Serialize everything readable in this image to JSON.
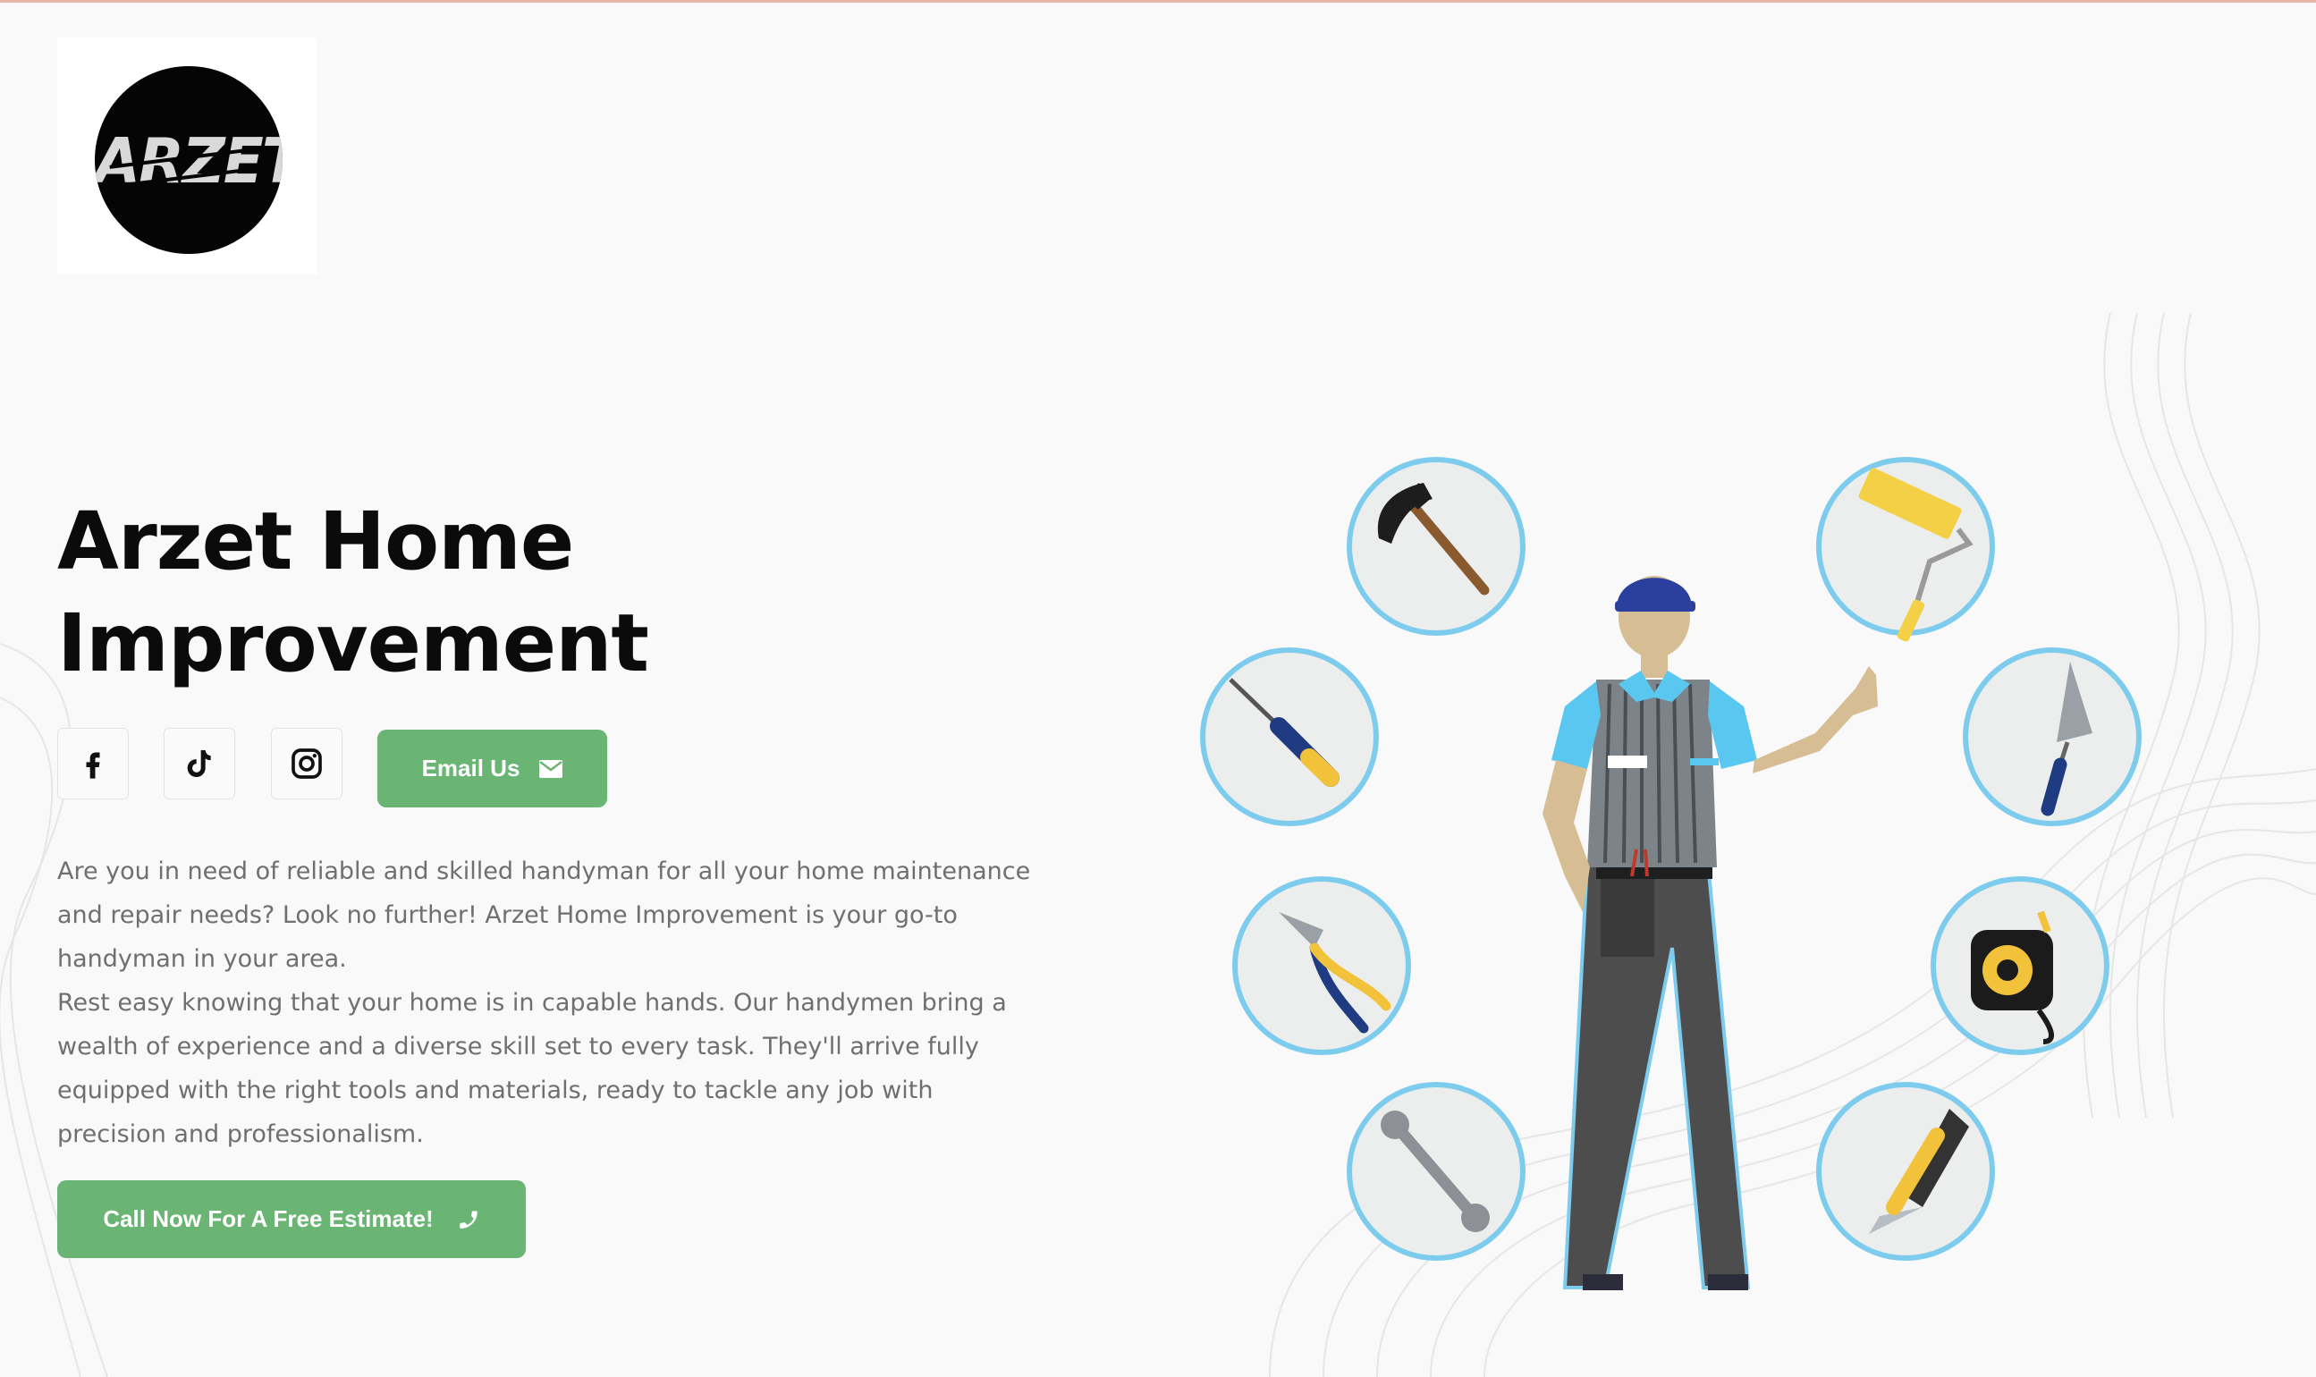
{
  "logo": {
    "text": "ARZET"
  },
  "hero": {
    "title_line1": "Arzet Home",
    "title_line2": "Improvement"
  },
  "social": {
    "items": [
      {
        "name": "facebook",
        "icon": "facebook-icon"
      },
      {
        "name": "tiktok",
        "icon": "tiktok-icon"
      },
      {
        "name": "instagram",
        "icon": "instagram-icon"
      }
    ],
    "email_label": "Email Us",
    "email_icon": "envelope-icon"
  },
  "description": {
    "paragraph1": "Are you in need of reliable and skilled handyman for all your home maintenance and repair needs? Look no further! Arzet Home Improvement is your go-to handyman in your area.",
    "paragraph2": "Rest easy knowing that your home is in capable hands. Our handymen bring a wealth of experience and a diverse skill set to every task. They'll arrive fully equipped with the right tools and materials, ready to tackle any job with precision and professionalism."
  },
  "cta": {
    "label": "Call Now For A Free Estimate!",
    "icon": "phone-icon"
  },
  "illustration": {
    "tools": [
      "hammer",
      "paint-roller",
      "screwdriver",
      "trowel",
      "pliers",
      "tape-measure",
      "wrench",
      "utility-knife"
    ]
  },
  "colors": {
    "background": "#f9f9f9",
    "accent_green": "#6ab574",
    "title": "#0b0b0b",
    "body_text": "#6f6f6f",
    "tool_circle_border": "#7dccee",
    "tool_circle_fill": "#eceeed"
  }
}
